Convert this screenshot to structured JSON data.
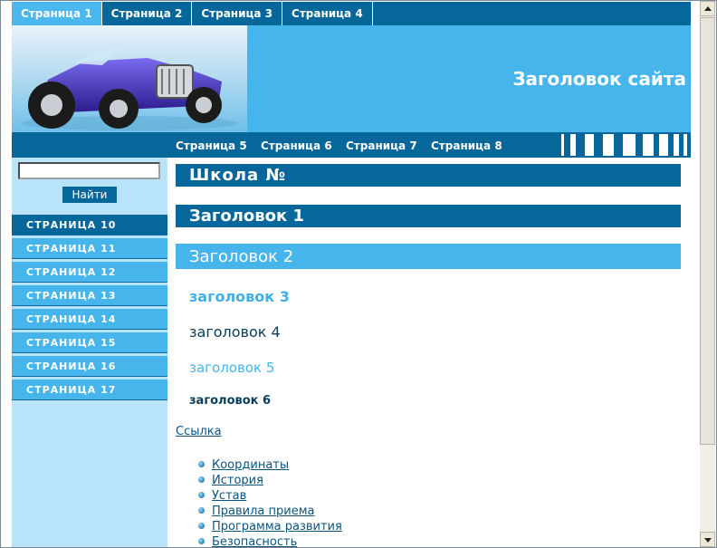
{
  "top_tabs": [
    "Страница 1",
    "Страница 2",
    "Страница 3",
    "Страница 4"
  ],
  "site_title": "Заголовок сайта",
  "sub_tabs": [
    "Страница 5",
    "Страница 6",
    "Страница 7",
    "Страница 8"
  ],
  "search": {
    "value": "",
    "button": "Найти"
  },
  "sidebar": [
    "СТРАНИЦА 10",
    "СТРАНИЦА 11",
    "СТРАНИЦА 12",
    "СТРАНИЦА 13",
    "СТРАНИЦА 14",
    "СТРАНИЦА 15",
    "СТРАНИЦА 16",
    "СТРАНИЦА 17"
  ],
  "content": {
    "school": "Школа №",
    "h1": "Заголовок 1",
    "h2": "Заголовок 2",
    "h3": "заголовок 3",
    "h4": "заголовок 4",
    "h5": "заголовок 5",
    "h6": "заголовок 6",
    "link": "Ссылка",
    "list": [
      "Координаты",
      "История",
      "Устав",
      "Правила приема",
      "Программа развития",
      "Безопасность"
    ]
  },
  "colors": {
    "dark_blue": "#08679a",
    "light_blue": "#45b5ec",
    "sidebar_bg": "#b9e3f8"
  },
  "icons": {
    "header_image": "hot-rod-car-image",
    "list_bullet": "blue-orb-bullet-icon"
  }
}
